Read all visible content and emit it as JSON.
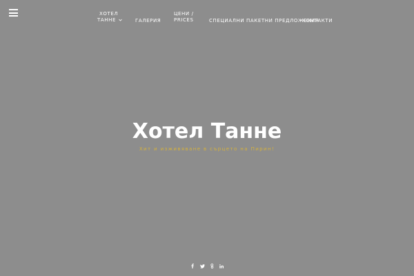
{
  "nav": {
    "menu_icon": "hamburger-menu-icon",
    "items": [
      {
        "line1": "Хотел",
        "line2": "Танне",
        "has_dropdown": true
      },
      {
        "label": "Галерия"
      },
      {
        "line1": "Цени /",
        "line2": "Prices"
      },
      {
        "label": "Специални пакетни предложения"
      },
      {
        "label": "Контакти"
      }
    ]
  },
  "hero": {
    "title": "Хотел Танне",
    "subtitle": "Хит и изживяване в сърцето на Пирин!"
  },
  "social": {
    "icons": [
      "facebook-icon",
      "twitter-icon",
      "google-plus-icon",
      "linkedin-icon"
    ]
  },
  "colors": {
    "background": "#8d8d8d",
    "text": "#ffffff",
    "accent": "#d6b23c"
  }
}
